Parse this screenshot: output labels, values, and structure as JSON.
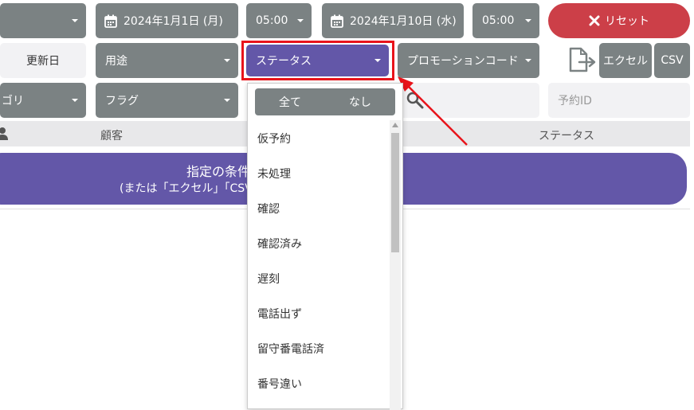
{
  "filters": {
    "date_start": "2024年1月1日 (月)",
    "time_start": "05:00",
    "date_end": "2024年1月10日 (水)",
    "time_end": "05:00",
    "reset_label": "リセット",
    "updated_label": "更新日",
    "usage_label": "用途",
    "status_label": "ステータス",
    "promo_label": "プロモーションコード",
    "excel_label": "エクセル",
    "csv_label": "CSV",
    "category_label": "ゴリ",
    "flag_label": "フラグ",
    "reservation_id_placeholder": "予約ID"
  },
  "table": {
    "col_customer": "顧客",
    "col_status": "ステータス"
  },
  "banner": {
    "line1": "指定の条件",
    "line2": "(または「エクセル」「CSV」を"
  },
  "dropdown": {
    "all_label": "全て",
    "none_label": "なし",
    "options": [
      "仮予約",
      "未処理",
      "確認",
      "確認済み",
      "遅刻",
      "電話出ず",
      "留守番電話済",
      "番号違い"
    ]
  },
  "colors": {
    "gray_button": "#7b8283",
    "accent_purple": "#6357a8",
    "reset_red": "#cc3f48",
    "highlight_red": "#e8141b"
  }
}
